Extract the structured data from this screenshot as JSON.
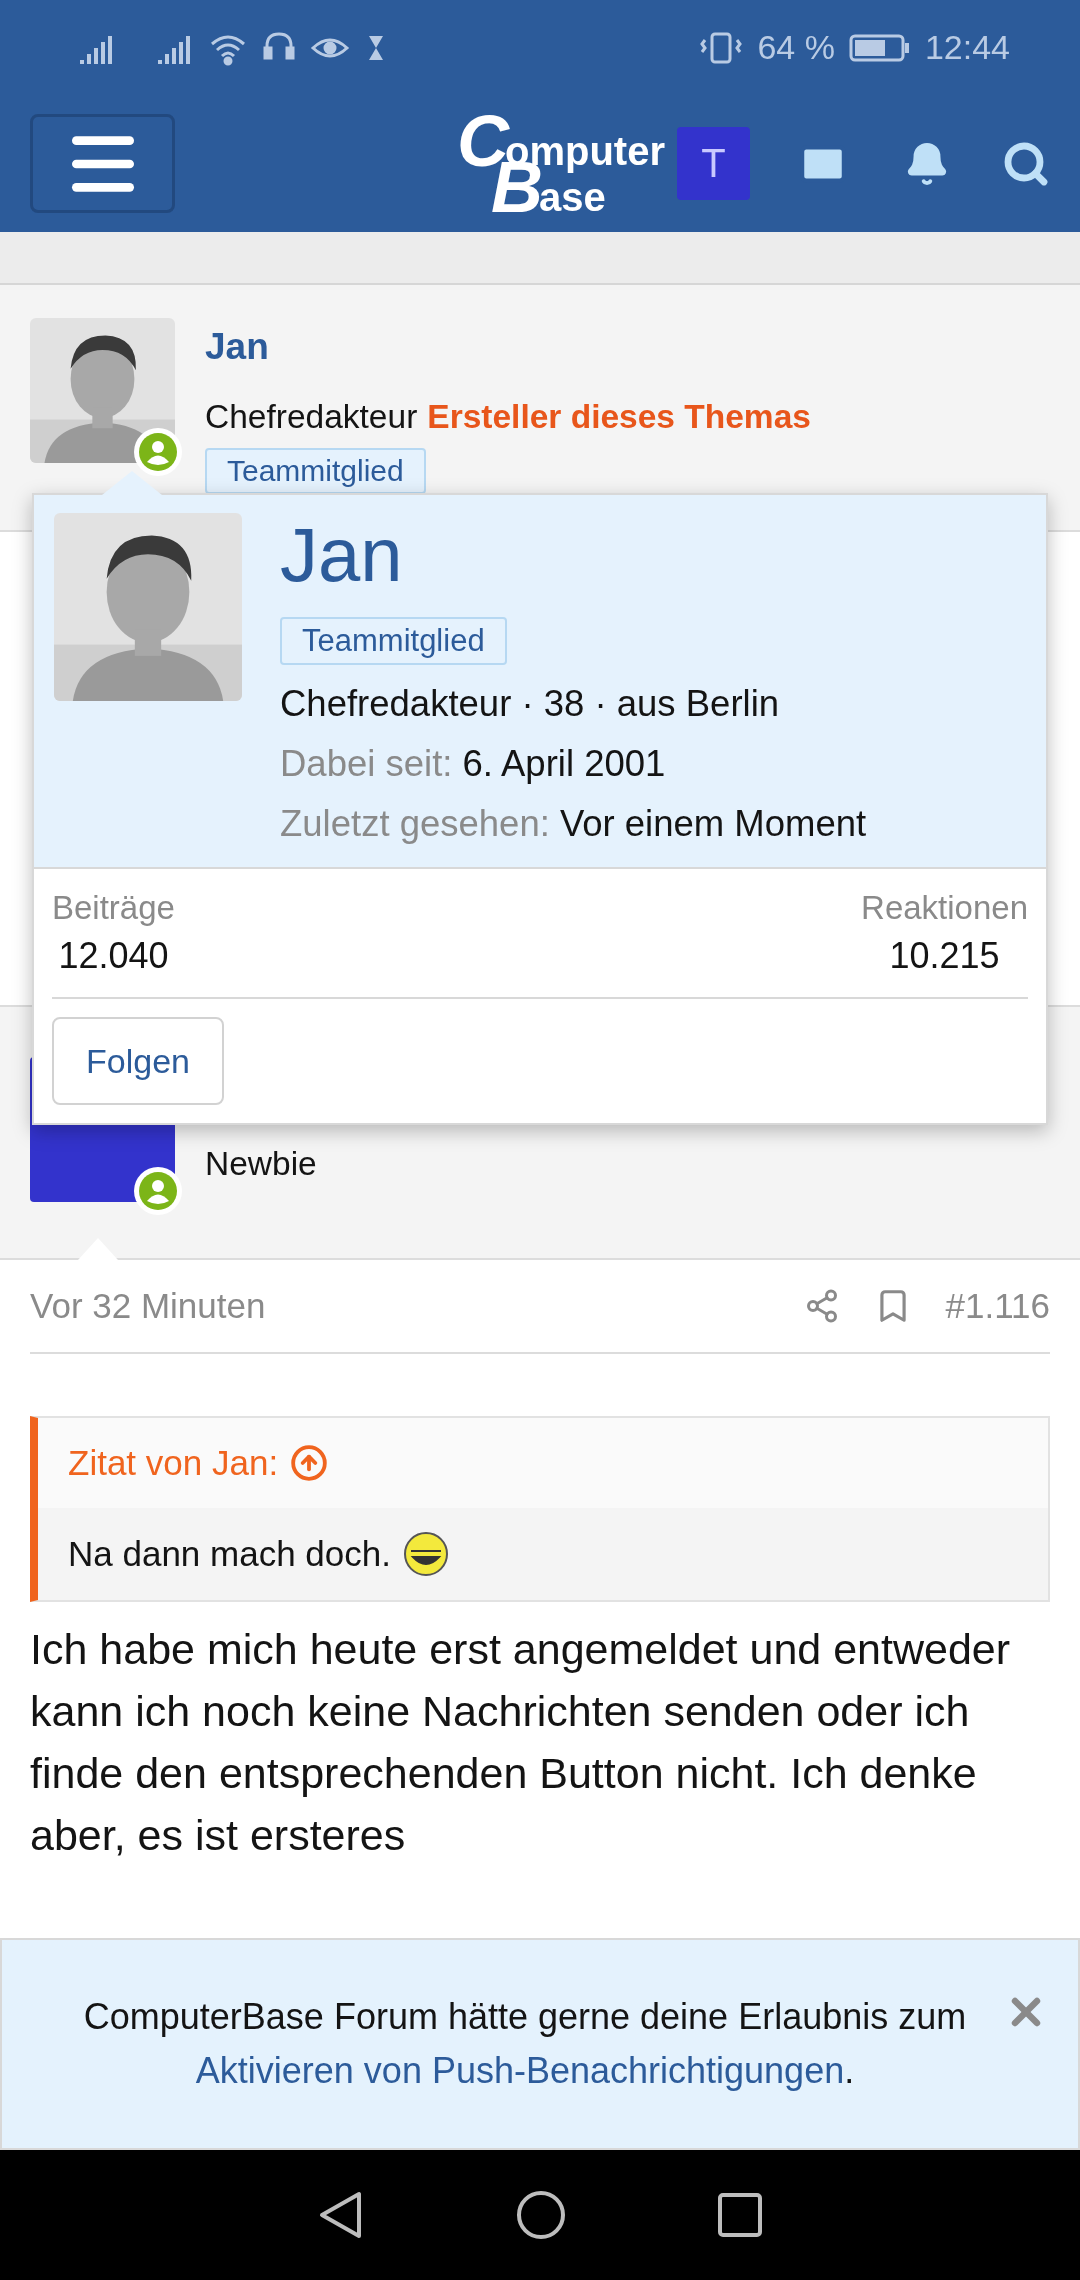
{
  "status_bar": {
    "battery": "64 %",
    "time": "12:44"
  },
  "header": {
    "logo": [
      "C",
      "omputer",
      "B",
      "ase"
    ],
    "avatar_letter": "T"
  },
  "posts": [
    {
      "author": "Jan",
      "role": "Chefredakteur",
      "creator_label": "Ersteller dieses Themas",
      "badge": "Teammitglied",
      "online": true
    },
    {
      "role": "Newbie",
      "online": true,
      "time": "Vor 32 Minuten",
      "number": "#1.116",
      "quote": {
        "title": "Zitat von Jan:",
        "text": "Na dann mach doch."
      },
      "body": "Ich habe mich heute erst angemeldet und entweder kann ich noch keine Nachrichten senden oder ich finde den entsprechenden Button nicht. Ich denke aber, es ist ersteres"
    }
  ],
  "member_tooltip": {
    "name": "Jan",
    "badge": "Teammitglied",
    "info": "Chefredakteur · 38 · aus Berlin",
    "facts": [
      {
        "label": "Dabei seit:",
        "value": "6. April 2001"
      },
      {
        "label": "Zuletzt gesehen:",
        "value": "Vor einem Moment"
      }
    ],
    "stats": [
      {
        "label": "Beiträge",
        "value": "12.040"
      },
      {
        "label": "Reaktionen",
        "value": "10.215"
      }
    ],
    "button": "Folgen"
  },
  "push_banner": {
    "text": "ComputerBase Forum hätte gerne deine Erlaubnis zum",
    "link": "Aktivieren von Push-Benachrichtigungen",
    "end": "."
  }
}
